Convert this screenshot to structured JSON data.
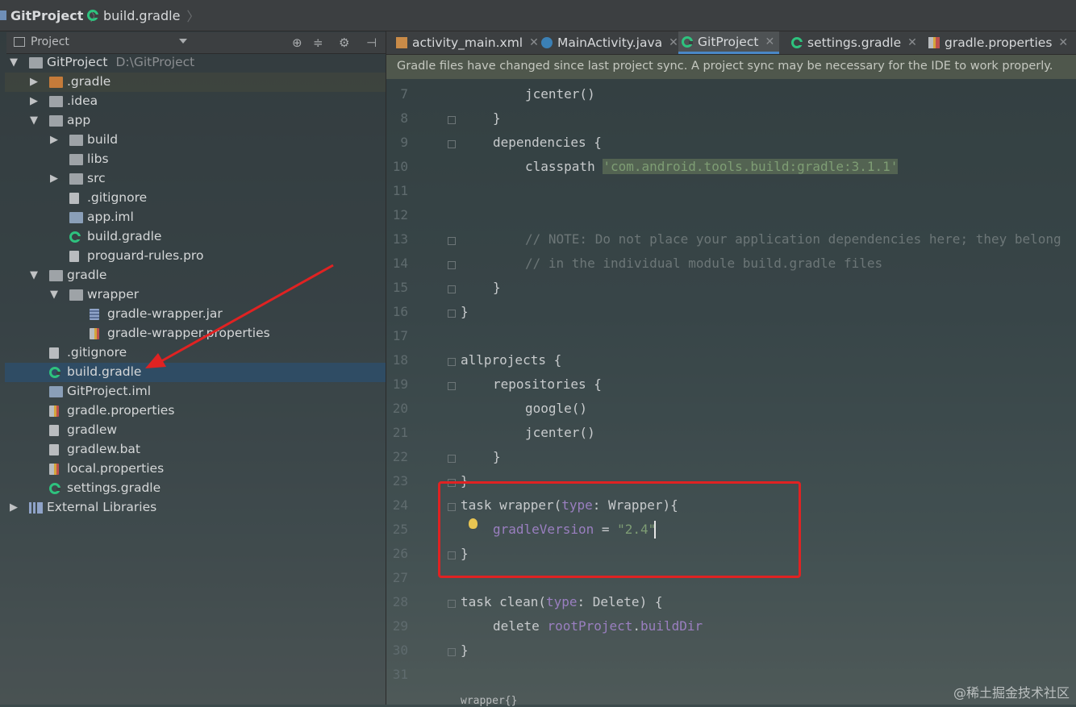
{
  "breadcrumb": {
    "project": "GitProject",
    "file": "build.gradle"
  },
  "project_panel": {
    "title": "Project",
    "tree": [
      {
        "label": "GitProject",
        "path": "D:\\GitProject",
        "arrow": "▼",
        "indent": 0,
        "icon": "module-folder-icon"
      },
      {
        "label": ".gradle",
        "arrow": "▶",
        "indent": 1,
        "icon": "orange-folder-icon"
      },
      {
        "label": ".idea",
        "arrow": "▶",
        "indent": 1,
        "icon": "folder-icon"
      },
      {
        "label": "app",
        "arrow": "▼",
        "indent": 1,
        "icon": "module-folder-icon"
      },
      {
        "label": "build",
        "arrow": "▶",
        "indent": 2,
        "icon": "folder-icon"
      },
      {
        "label": "libs",
        "arrow": "",
        "indent": 2,
        "icon": "folder-icon"
      },
      {
        "label": "src",
        "arrow": "▶",
        "indent": 2,
        "icon": "folder-icon"
      },
      {
        "label": ".gitignore",
        "arrow": "",
        "indent": 2,
        "icon": "text-file-icon"
      },
      {
        "label": "app.iml",
        "arrow": "",
        "indent": 2,
        "icon": "iml-file-icon"
      },
      {
        "label": "build.gradle",
        "arrow": "",
        "indent": 2,
        "icon": "gradle-icon"
      },
      {
        "label": "proguard-rules.pro",
        "arrow": "",
        "indent": 2,
        "icon": "text-file-icon"
      },
      {
        "label": "gradle",
        "arrow": "▼",
        "indent": 1,
        "icon": "folder-icon"
      },
      {
        "label": "wrapper",
        "arrow": "▼",
        "indent": 2,
        "icon": "folder-icon"
      },
      {
        "label": "gradle-wrapper.jar",
        "arrow": "",
        "indent": 3,
        "icon": "jar-file-icon"
      },
      {
        "label": "gradle-wrapper.properties",
        "arrow": "",
        "indent": 3,
        "icon": "properties-file-icon"
      },
      {
        "label": ".gitignore",
        "arrow": "",
        "indent": 1,
        "icon": "text-file-icon"
      },
      {
        "label": "build.gradle",
        "arrow": "",
        "indent": 1,
        "icon": "gradle-icon",
        "selected": true
      },
      {
        "label": "GitProject.iml",
        "arrow": "",
        "indent": 1,
        "icon": "iml-file-icon"
      },
      {
        "label": "gradle.properties",
        "arrow": "",
        "indent": 1,
        "icon": "properties-file-icon"
      },
      {
        "label": "gradlew",
        "arrow": "",
        "indent": 1,
        "icon": "text-file-icon"
      },
      {
        "label": "gradlew.bat",
        "arrow": "",
        "indent": 1,
        "icon": "text-file-icon"
      },
      {
        "label": "local.properties",
        "arrow": "",
        "indent": 1,
        "icon": "properties-file-icon"
      },
      {
        "label": "settings.gradle",
        "arrow": "",
        "indent": 1,
        "icon": "gradle-icon"
      },
      {
        "label": "External Libraries",
        "arrow": "▶",
        "indent": 0,
        "icon": "libraries-icon"
      }
    ]
  },
  "tabs": [
    {
      "label": "activity_main.xml",
      "icon": "xml-file-icon"
    },
    {
      "label": "MainActivity.java",
      "icon": "java-class-icon"
    },
    {
      "label": "GitProject",
      "icon": "gradle-icon",
      "active": true
    },
    {
      "label": "settings.gradle",
      "icon": "gradle-icon"
    },
    {
      "label": "gradle.properties",
      "icon": "properties-file-icon"
    }
  ],
  "banner": "Gradle files have changed since last project sync. A project sync may be necessary for the IDE to work properly.",
  "code_lines": [
    {
      "n": "7",
      "indent": 2,
      "parts": [
        [
          "jcenter()",
          "kw"
        ]
      ]
    },
    {
      "n": "8",
      "indent": 1,
      "parts": [
        [
          "}",
          "kw"
        ]
      ]
    },
    {
      "n": "9",
      "indent": 1,
      "parts": [
        [
          "dependencies {",
          "kw"
        ]
      ]
    },
    {
      "n": "10",
      "indent": 2,
      "parts": [
        [
          "classpath ",
          "kw"
        ],
        [
          "'com.android.tools.build:gradle:3.1.1'",
          "str"
        ]
      ]
    },
    {
      "n": "11",
      "indent": 0,
      "parts": []
    },
    {
      "n": "12",
      "indent": 0,
      "parts": []
    },
    {
      "n": "13",
      "indent": 2,
      "parts": [
        [
          "// NOTE: Do not place your application dependencies here; they belong",
          "cmt"
        ]
      ]
    },
    {
      "n": "14",
      "indent": 2,
      "parts": [
        [
          "// in the individual module build.gradle files",
          "cmt"
        ]
      ]
    },
    {
      "n": "15",
      "indent": 1,
      "parts": [
        [
          "}",
          "kw"
        ]
      ]
    },
    {
      "n": "16",
      "indent": 0,
      "parts": [
        [
          "}",
          "kw"
        ]
      ]
    },
    {
      "n": "17",
      "indent": 0,
      "parts": []
    },
    {
      "n": "18",
      "indent": 0,
      "parts": [
        [
          "allprojects {",
          "kw"
        ]
      ]
    },
    {
      "n": "19",
      "indent": 1,
      "parts": [
        [
          "repositories {",
          "kw"
        ]
      ]
    },
    {
      "n": "20",
      "indent": 2,
      "parts": [
        [
          "google()",
          "kw"
        ]
      ]
    },
    {
      "n": "21",
      "indent": 2,
      "parts": [
        [
          "jcenter()",
          "kw"
        ]
      ]
    },
    {
      "n": "22",
      "indent": 1,
      "parts": [
        [
          "}",
          "kw"
        ]
      ]
    },
    {
      "n": "23",
      "indent": 0,
      "parts": [
        [
          "}",
          "kw"
        ]
      ]
    },
    {
      "n": "24",
      "indent": 0,
      "parts": [
        [
          "task wrapper(",
          "kw"
        ],
        [
          "type",
          "prm"
        ],
        [
          ": Wrapper){",
          "kw"
        ]
      ]
    },
    {
      "n": "25",
      "indent": 1,
      "parts": [
        [
          "gradleVersion",
          "prm"
        ],
        [
          " = ",
          "kw"
        ],
        [
          "\"2.4\"",
          "str"
        ]
      ]
    },
    {
      "n": "26",
      "indent": 0,
      "parts": [
        [
          "}",
          "kw"
        ]
      ]
    },
    {
      "n": "27",
      "indent": 0,
      "parts": []
    },
    {
      "n": "28",
      "indent": 0,
      "parts": [
        [
          "task clean(",
          "kw"
        ],
        [
          "type",
          "prm"
        ],
        [
          ": Delete) {",
          "kw"
        ]
      ]
    },
    {
      "n": "29",
      "indent": 1,
      "parts": [
        [
          "delete ",
          "kw"
        ],
        [
          "rootProject",
          "prm"
        ],
        [
          ".",
          "kw"
        ],
        [
          "buildDir",
          "prm"
        ]
      ]
    },
    {
      "n": "30",
      "indent": 0,
      "parts": [
        [
          "}",
          "kw"
        ]
      ]
    },
    {
      "n": "31",
      "indent": 0,
      "parts": []
    }
  ],
  "status_hint": "wrapper{}",
  "watermark": "@稀土掘金技术社区",
  "colors": {
    "annotation": "#e02222",
    "selection": "#2f4c64",
    "gradle": "#2ec27e"
  }
}
